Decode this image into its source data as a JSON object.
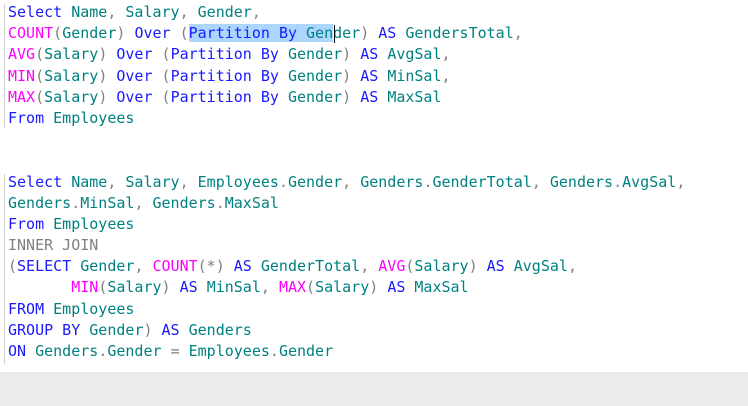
{
  "editor": {
    "lines": [
      [
        {
          "t": "Select",
          "c": "kw"
        },
        {
          "t": " "
        },
        {
          "t": "Name",
          "c": "id"
        },
        {
          "t": ",",
          "c": "gray"
        },
        {
          "t": " "
        },
        {
          "t": "Salary",
          "c": "id"
        },
        {
          "t": ",",
          "c": "gray"
        },
        {
          "t": " "
        },
        {
          "t": "Gender",
          "c": "id"
        },
        {
          "t": ",",
          "c": "gray"
        }
      ],
      [
        {
          "t": "COUNT",
          "c": "fn"
        },
        {
          "t": "(",
          "c": "gray"
        },
        {
          "t": "Gender",
          "c": "id"
        },
        {
          "t": ")",
          "c": "gray"
        },
        {
          "t": " "
        },
        {
          "t": "Over",
          "c": "kw"
        },
        {
          "t": " "
        },
        {
          "t": "(",
          "c": "gray"
        },
        {
          "t": "Partition",
          "c": "kw",
          "s": true
        },
        {
          "t": " ",
          "s": true
        },
        {
          "t": "By",
          "c": "kw",
          "s": true
        },
        {
          "t": " ",
          "s": true
        },
        {
          "t": "Gen",
          "c": "id",
          "s": true
        },
        {
          "t": "der",
          "c": "id"
        },
        {
          "t": ")",
          "c": "gray"
        },
        {
          "t": " "
        },
        {
          "t": "AS",
          "c": "kw"
        },
        {
          "t": " "
        },
        {
          "t": "GendersTotal",
          "c": "id"
        },
        {
          "t": ",",
          "c": "gray"
        }
      ],
      [
        {
          "t": "AVG",
          "c": "fn"
        },
        {
          "t": "(",
          "c": "gray"
        },
        {
          "t": "Salary",
          "c": "id"
        },
        {
          "t": ")",
          "c": "gray"
        },
        {
          "t": " "
        },
        {
          "t": "Over",
          "c": "kw"
        },
        {
          "t": " "
        },
        {
          "t": "(",
          "c": "gray"
        },
        {
          "t": "Partition",
          "c": "kw"
        },
        {
          "t": " "
        },
        {
          "t": "By",
          "c": "kw"
        },
        {
          "t": " "
        },
        {
          "t": "Gender",
          "c": "id"
        },
        {
          "t": ")",
          "c": "gray"
        },
        {
          "t": " "
        },
        {
          "t": "AS",
          "c": "kw"
        },
        {
          "t": " "
        },
        {
          "t": "AvgSal",
          "c": "id"
        },
        {
          "t": ",",
          "c": "gray"
        }
      ],
      [
        {
          "t": "MIN",
          "c": "fn"
        },
        {
          "t": "(",
          "c": "gray"
        },
        {
          "t": "Salary",
          "c": "id"
        },
        {
          "t": ")",
          "c": "gray"
        },
        {
          "t": " "
        },
        {
          "t": "Over",
          "c": "kw"
        },
        {
          "t": " "
        },
        {
          "t": "(",
          "c": "gray"
        },
        {
          "t": "Partition",
          "c": "kw"
        },
        {
          "t": " "
        },
        {
          "t": "By",
          "c": "kw"
        },
        {
          "t": " "
        },
        {
          "t": "Gender",
          "c": "id"
        },
        {
          "t": ")",
          "c": "gray"
        },
        {
          "t": " "
        },
        {
          "t": "AS",
          "c": "kw"
        },
        {
          "t": " "
        },
        {
          "t": "MinSal",
          "c": "id"
        },
        {
          "t": ",",
          "c": "gray"
        }
      ],
      [
        {
          "t": "MAX",
          "c": "fn"
        },
        {
          "t": "(",
          "c": "gray"
        },
        {
          "t": "Salary",
          "c": "id"
        },
        {
          "t": ")",
          "c": "gray"
        },
        {
          "t": " "
        },
        {
          "t": "Over",
          "c": "kw"
        },
        {
          "t": " "
        },
        {
          "t": "(",
          "c": "gray"
        },
        {
          "t": "Partition",
          "c": "kw"
        },
        {
          "t": " "
        },
        {
          "t": "By",
          "c": "kw"
        },
        {
          "t": " "
        },
        {
          "t": "Gender",
          "c": "id"
        },
        {
          "t": ")",
          "c": "gray"
        },
        {
          "t": " "
        },
        {
          "t": "AS",
          "c": "kw"
        },
        {
          "t": " "
        },
        {
          "t": "MaxSal",
          "c": "id"
        }
      ],
      [
        {
          "t": "From",
          "c": "kw"
        },
        {
          "t": " "
        },
        {
          "t": "Employees",
          "c": "id"
        }
      ],
      [],
      [],
      [
        {
          "t": "Select",
          "c": "kw"
        },
        {
          "t": " "
        },
        {
          "t": "Name",
          "c": "id"
        },
        {
          "t": ",",
          "c": "gray"
        },
        {
          "t": " "
        },
        {
          "t": "Salary",
          "c": "id"
        },
        {
          "t": ",",
          "c": "gray"
        },
        {
          "t": " "
        },
        {
          "t": "Employees",
          "c": "id"
        },
        {
          "t": ".",
          "c": "gray"
        },
        {
          "t": "Gender",
          "c": "id"
        },
        {
          "t": ",",
          "c": "gray"
        },
        {
          "t": " "
        },
        {
          "t": "Genders",
          "c": "id"
        },
        {
          "t": ".",
          "c": "gray"
        },
        {
          "t": "GenderTotal",
          "c": "id"
        },
        {
          "t": ",",
          "c": "gray"
        },
        {
          "t": " "
        },
        {
          "t": "Genders",
          "c": "id"
        },
        {
          "t": ".",
          "c": "gray"
        },
        {
          "t": "AvgSal",
          "c": "id"
        },
        {
          "t": ",",
          "c": "gray"
        }
      ],
      [
        {
          "t": "Genders",
          "c": "id"
        },
        {
          "t": ".",
          "c": "gray"
        },
        {
          "t": "MinSal",
          "c": "id"
        },
        {
          "t": ",",
          "c": "gray"
        },
        {
          "t": " "
        },
        {
          "t": "Genders",
          "c": "id"
        },
        {
          "t": ".",
          "c": "gray"
        },
        {
          "t": "MaxSal",
          "c": "id"
        }
      ],
      [
        {
          "t": "From",
          "c": "kw"
        },
        {
          "t": " "
        },
        {
          "t": "Employees",
          "c": "id"
        }
      ],
      [
        {
          "t": "INNER JOIN",
          "c": "gray"
        }
      ],
      [
        {
          "t": "(",
          "c": "gray"
        },
        {
          "t": "SELECT",
          "c": "kw"
        },
        {
          "t": " "
        },
        {
          "t": "Gender",
          "c": "id"
        },
        {
          "t": ",",
          "c": "gray"
        },
        {
          "t": " "
        },
        {
          "t": "COUNT",
          "c": "fn"
        },
        {
          "t": "(*)",
          "c": "gray"
        },
        {
          "t": " "
        },
        {
          "t": "AS",
          "c": "kw"
        },
        {
          "t": " "
        },
        {
          "t": "GenderTotal",
          "c": "id"
        },
        {
          "t": ",",
          "c": "gray"
        },
        {
          "t": " "
        },
        {
          "t": "AVG",
          "c": "fn"
        },
        {
          "t": "(",
          "c": "gray"
        },
        {
          "t": "Salary",
          "c": "id"
        },
        {
          "t": ")",
          "c": "gray"
        },
        {
          "t": " "
        },
        {
          "t": "AS",
          "c": "kw"
        },
        {
          "t": " "
        },
        {
          "t": "AvgSal",
          "c": "id"
        },
        {
          "t": ",",
          "c": "gray"
        }
      ],
      [
        {
          "t": "       "
        },
        {
          "t": "MIN",
          "c": "fn"
        },
        {
          "t": "(",
          "c": "gray"
        },
        {
          "t": "Salary",
          "c": "id"
        },
        {
          "t": ")",
          "c": "gray"
        },
        {
          "t": " "
        },
        {
          "t": "AS",
          "c": "kw"
        },
        {
          "t": " "
        },
        {
          "t": "MinSal",
          "c": "id"
        },
        {
          "t": ",",
          "c": "gray"
        },
        {
          "t": " "
        },
        {
          "t": "MAX",
          "c": "fn"
        },
        {
          "t": "(",
          "c": "gray"
        },
        {
          "t": "Salary",
          "c": "id"
        },
        {
          "t": ")",
          "c": "gray"
        },
        {
          "t": " "
        },
        {
          "t": "AS",
          "c": "kw"
        },
        {
          "t": " "
        },
        {
          "t": "MaxSal",
          "c": "id"
        }
      ],
      [
        {
          "t": "FROM",
          "c": "kw"
        },
        {
          "t": " "
        },
        {
          "t": "Employees",
          "c": "id"
        }
      ],
      [
        {
          "t": "GROUP BY",
          "c": "kw"
        },
        {
          "t": " "
        },
        {
          "t": "Gender",
          "c": "id"
        },
        {
          "t": ")",
          "c": "gray"
        },
        {
          "t": " "
        },
        {
          "t": "AS",
          "c": "kw"
        },
        {
          "t": " "
        },
        {
          "t": "Genders",
          "c": "id"
        }
      ],
      [
        {
          "t": "ON",
          "c": "kw"
        },
        {
          "t": " "
        },
        {
          "t": "Genders",
          "c": "id"
        },
        {
          "t": ".",
          "c": "gray"
        },
        {
          "t": "Gender",
          "c": "id"
        },
        {
          "t": " "
        },
        {
          "t": "=",
          "c": "gray"
        },
        {
          "t": " "
        },
        {
          "t": "Employees",
          "c": "id"
        },
        {
          "t": ".",
          "c": "gray"
        },
        {
          "t": "Gender",
          "c": "id"
        }
      ]
    ]
  }
}
